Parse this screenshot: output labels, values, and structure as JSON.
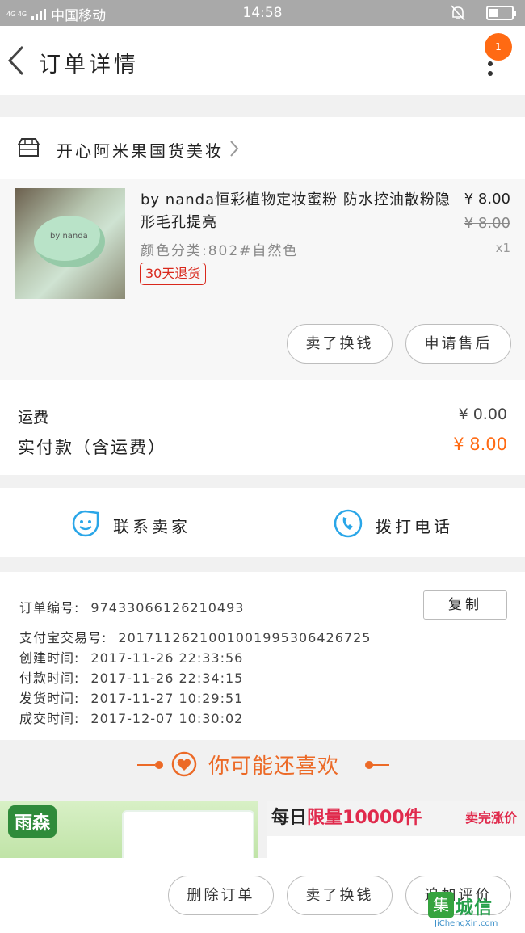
{
  "status_bar": {
    "network": "4G 4G",
    "carrier": "中国移动",
    "time": "14:58",
    "battery_level": 0.35
  },
  "header": {
    "title": "订单详情",
    "badge_count": "1"
  },
  "shop": {
    "name": "开心阿米果国货美妆"
  },
  "product": {
    "image_text": "by nanda",
    "name": "by nanda恒彩植物定妆蜜粉 防水控油散粉隐形毛孔提亮",
    "sku": "颜色分类:802#自然色",
    "price": "¥ 8.00",
    "original_price": "¥ 8.00",
    "quantity": "x1",
    "tag": "30天退货",
    "buttons": {
      "sell": "卖了换钱",
      "after_sale": "申请售后"
    }
  },
  "totals": {
    "shipping_label": "运费",
    "shipping_value": "¥ 0.00",
    "paid_label": "实付款（含运费）",
    "paid_value": "¥ 8.00"
  },
  "contact": {
    "seller": "联系卖家",
    "phone": "拨打电话"
  },
  "order_info": {
    "copy_button": "复制",
    "lines": [
      {
        "label": "订单编号:",
        "value": "97433066126210493"
      },
      {
        "label": "支付宝交易号:",
        "value": "2017112621001001995306426725"
      },
      {
        "label": "创建时间:",
        "value": "2017-11-26 22:33:56"
      },
      {
        "label": "付款时间:",
        "value": "2017-11-26 22:34:15"
      },
      {
        "label": "发货时间:",
        "value": "2017-11-27 10:29:51"
      },
      {
        "label": "成交时间:",
        "value": "2017-12-07 10:30:02"
      }
    ]
  },
  "recommend": {
    "title": "你可能还喜欢",
    "item_a_brand": "雨森",
    "item_b_banner": "每日",
    "item_b_banner_red": "限量10000件",
    "item_b_tag": "卖完涨价"
  },
  "bottom_bar": {
    "delete": "删除订单",
    "sell": "卖了换钱",
    "review": "追加评价"
  },
  "watermark": {
    "mark": "集",
    "text": "城信",
    "url": "JiChengXin.com"
  },
  "colors": {
    "accent": "#ff6a13",
    "icon_blue": "#2aa6e8",
    "tag_red": "#d9281c"
  }
}
